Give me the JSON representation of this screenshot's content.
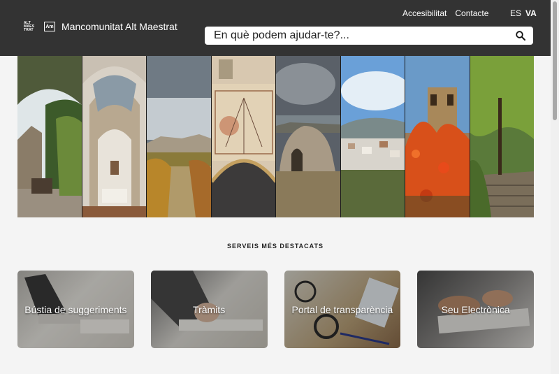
{
  "header": {
    "logo_text": "ALT MAES TRAT",
    "logo_box": "Am",
    "site_name": "Mancomunitat Alt Maestrat",
    "nav": [
      "Accesibilitat",
      "Contacte"
    ],
    "languages": [
      "ES",
      "VA"
    ],
    "active_language": "VA",
    "search_placeholder": "En què podem ajudar-te?..."
  },
  "hero": {
    "panels": [
      "stone-arch-garden",
      "church-interior",
      "village-landscape",
      "sundial-facade",
      "stone-hut",
      "hilltop-village",
      "bell-tower-autumn",
      "stone-stairs-forest"
    ]
  },
  "services": {
    "title": "SERVEIS MÉS DESTACATS",
    "cards": [
      {
        "label": "Bústia de suggeriments"
      },
      {
        "label": "Tràmits"
      },
      {
        "label": "Portal de transparència"
      },
      {
        "label": "Seu Electrònica"
      }
    ]
  }
}
